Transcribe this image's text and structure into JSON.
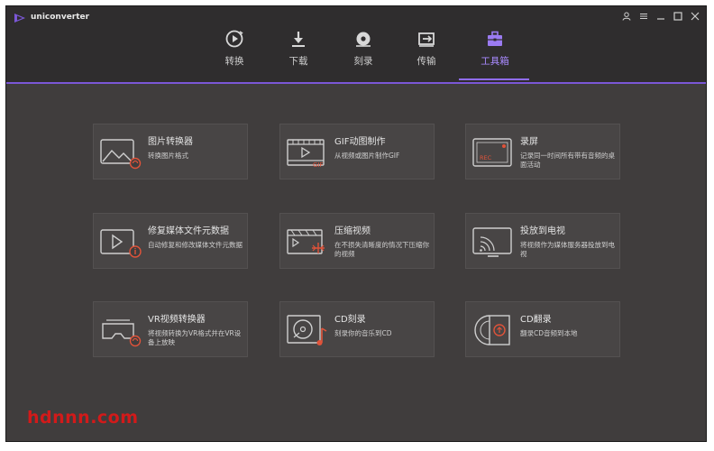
{
  "app": {
    "title": "uniconverter"
  },
  "nav": {
    "tabs": [
      {
        "label": "转换",
        "icon": "convert-icon"
      },
      {
        "label": "下载",
        "icon": "download-icon"
      },
      {
        "label": "刻录",
        "icon": "burn-icon"
      },
      {
        "label": "传输",
        "icon": "transfer-icon"
      },
      {
        "label": "工具箱",
        "icon": "toolbox-icon",
        "active": true
      }
    ]
  },
  "tools": [
    {
      "title": "图片转换器",
      "desc": "转换图片格式",
      "icon": "image-convert-icon"
    },
    {
      "title": "GIF动图制作",
      "desc": "从视频或图片制作GIF",
      "icon": "gif-maker-icon"
    },
    {
      "title": "录屏",
      "desc": "记录同一时间所有带有音频的桌面活动",
      "icon": "screen-record-icon"
    },
    {
      "title": "修复媒体文件元数据",
      "desc": "自动修复和修改媒体文件元数据",
      "icon": "metadata-fix-icon"
    },
    {
      "title": "压缩视频",
      "desc": "在不损失清晰度的情况下压缩你的视频",
      "icon": "compress-video-icon"
    },
    {
      "title": "投放到电视",
      "desc": "将视频作为媒体服务器投放到电视",
      "icon": "cast-tv-icon"
    },
    {
      "title": "VR视频转换器",
      "desc": "将视频转换为VR格式并在VR设备上放映",
      "icon": "vr-convert-icon"
    },
    {
      "title": "CD刻录",
      "desc": "刻录你的音乐到CD",
      "icon": "cd-burn-icon"
    },
    {
      "title": "CD翻录",
      "desc": "翻录CD音频到本地",
      "icon": "cd-rip-icon"
    }
  ],
  "watermark": "hdnnn.com",
  "colors": {
    "accent": "#8f6cf0",
    "background": "#403d3d",
    "titlebar": "#2f2d2e",
    "badge": "#e0533a"
  }
}
